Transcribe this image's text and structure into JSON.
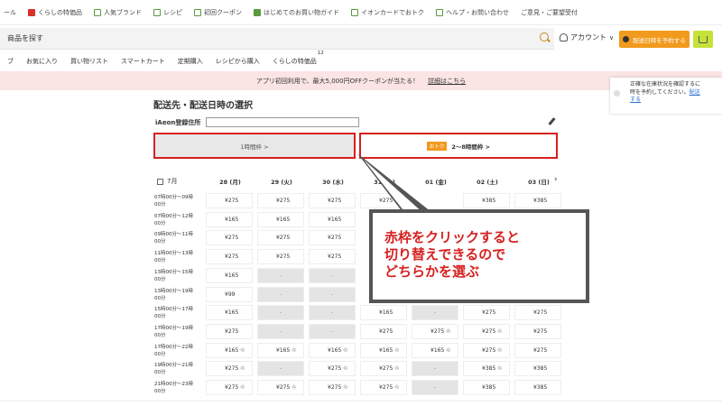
{
  "topbar": {
    "items": [
      {
        "label": "ール",
        "icon": "none"
      },
      {
        "label": "くらしの特価品",
        "icon": "megaphone-icon"
      },
      {
        "label": "人気ブランド",
        "icon": "shop-icon"
      },
      {
        "label": "レシピ",
        "icon": "recipe-icon"
      },
      {
        "label": "初回クーポン",
        "icon": "coupon-icon"
      },
      {
        "label": "はじめてのお買い物ガイド",
        "icon": "shield-icon"
      },
      {
        "label": "イオンカードでおトク",
        "icon": "card-icon"
      },
      {
        "label": "ヘルプ・お問い合わせ",
        "icon": "help-icon"
      },
      {
        "label": "ご意見・ご要望受付",
        "icon": "none"
      }
    ]
  },
  "search": {
    "placeholder": "商品を探す"
  },
  "account": {
    "label": "アカウント"
  },
  "reserve_button": {
    "label": "配送日時を予約する"
  },
  "nav": {
    "items": [
      {
        "label": "ブ"
      },
      {
        "label": "お気に入り"
      },
      {
        "label": "買い物リスト"
      },
      {
        "label": "スマートカート"
      },
      {
        "label": "定期購入"
      },
      {
        "label": "レシピから購入"
      },
      {
        "label": "くらしの特価品",
        "badge": "12"
      }
    ]
  },
  "promo": {
    "text": "アプリ初回利用で、最大5,000円OFFクーポンが当たる！",
    "link": "詳細はこちら"
  },
  "notice": {
    "line1": "正確な在庫状況を確認するに",
    "line2": "時を予約してください。",
    "link1": "配送",
    "link2": "する"
  },
  "page_title": "配送先・配送日時の選択",
  "address": {
    "label": "iAeon登録住所"
  },
  "segments": {
    "one_hour": "1時間枠 >",
    "two_hour_tag": "おトク",
    "two_hour": "2～8時間枠 >"
  },
  "schedule": {
    "month": "7月",
    "days": [
      "28 (月)",
      "29 (火)",
      "30 (水)",
      "31 (木)",
      "01 (金)",
      "02 (土)",
      "03 (日)"
    ],
    "slots": [
      {
        "line1": "07時00分～09時",
        "line2": "00分"
      },
      {
        "line1": "07時00分～12時",
        "line2": "00分"
      },
      {
        "line1": "09時00分～11時",
        "line2": "00分"
      },
      {
        "line1": "11時00分～13時",
        "line2": "00分"
      },
      {
        "line1": "13時00分～15時",
        "line2": "00分"
      },
      {
        "line1": "13時00分～19時",
        "line2": "00分"
      },
      {
        "line1": "15時00分～17時",
        "line2": "00分"
      },
      {
        "line1": "17時00分～19時",
        "line2": "00分"
      },
      {
        "line1": "17時00分～22時",
        "line2": "00分"
      },
      {
        "line1": "19時00分～21時",
        "line2": "00分"
      },
      {
        "line1": "21時00分～23時",
        "line2": "00分"
      }
    ],
    "na": "-",
    "eco": "♲",
    "prices": [
      [
        "¥275",
        "¥275",
        "¥275",
        "¥275",
        "",
        "¥385",
        "¥385"
      ],
      [
        "¥165",
        "¥165",
        "¥165",
        "",
        "",
        "",
        ""
      ],
      [
        "¥275",
        "¥275",
        "¥275",
        "",
        "",
        "",
        ""
      ],
      [
        "¥275",
        "¥275",
        "¥275",
        "",
        "",
        "",
        ""
      ],
      [
        "¥165",
        "-",
        "-",
        "",
        "",
        "",
        ""
      ],
      [
        "¥99",
        "-",
        "-",
        "",
        "",
        "",
        ""
      ],
      [
        "¥165",
        "-",
        "-",
        "¥165",
        "-",
        "¥275",
        "¥275"
      ],
      [
        "¥275",
        "-",
        "-",
        "¥275",
        "¥275 ♲",
        "¥275 ♲",
        "¥275"
      ],
      [
        "¥165 ♲",
        "¥165 ♲",
        "¥165 ♲",
        "¥165 ♲",
        "¥165 ♲",
        "¥275 ♲",
        "¥275"
      ],
      [
        "¥275 ♲",
        "-",
        "¥275 ♲",
        "¥275 ♲",
        "-",
        "¥385 ♲",
        "¥385"
      ],
      [
        "¥275 ♲",
        "¥275 ♲",
        "¥275 ♲",
        "¥275 ♲",
        "-",
        "¥385",
        "¥385"
      ]
    ]
  },
  "callout": {
    "line1": "赤枠をクリックすると",
    "line2": "切り替えできるので",
    "line3": "どちらかを選ぶ"
  },
  "colors": {
    "accent_red": "#d62020",
    "orange": "#f29a1d",
    "lime": "#c6e23a",
    "promo_bg": "#fbe4e4"
  }
}
